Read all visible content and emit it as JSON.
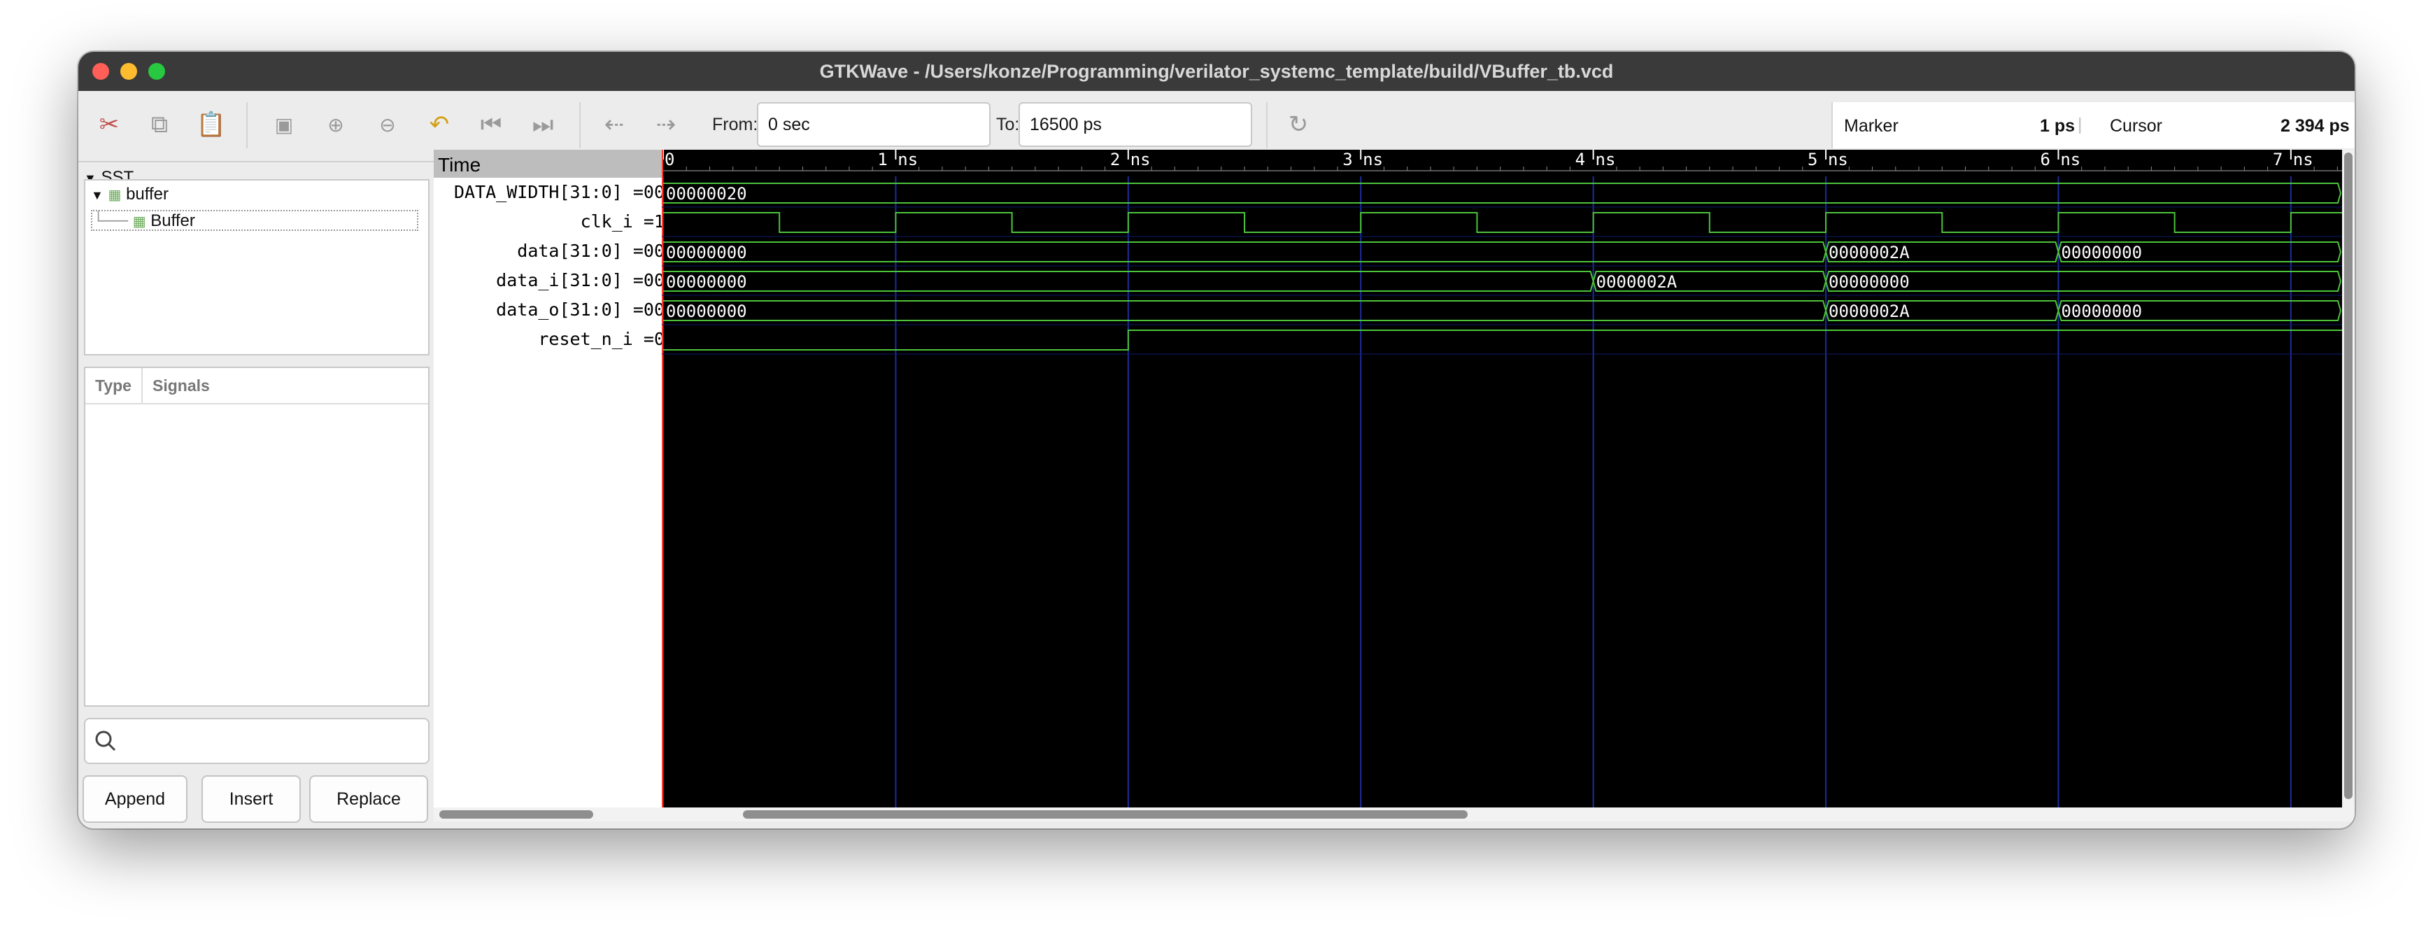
{
  "window": {
    "title": "GTKWave - /Users/konze/Programming/verilator_systemc_template/build/VBuffer_tb.vcd"
  },
  "toolbar": {
    "icons": [
      "cut-icon",
      "copy-icon",
      "paste-icon",
      "zoom-fit-icon",
      "zoom-in-icon",
      "zoom-out-icon",
      "undo-icon",
      "jump-start-icon",
      "jump-end-icon",
      "prev-edge-icon",
      "next-edge-icon",
      "reload-icon"
    ],
    "from_label": "From:",
    "from_value": "0 sec",
    "to_label": "To:",
    "to_value": "16500 ps",
    "marker_label": "Marker",
    "marker_value": "1 ps",
    "cursor_label": "Cursor",
    "cursor_value": "2 394 ps"
  },
  "sst": {
    "header": "SST",
    "tree": [
      {
        "label": "buffer",
        "level": 0
      },
      {
        "label": "Buffer",
        "level": 1
      }
    ]
  },
  "signals_panel": {
    "col_type": "Type",
    "col_signals": "Signals",
    "search_placeholder": ""
  },
  "buttons": {
    "append": "Append",
    "insert": "Insert",
    "replace": "Replace"
  },
  "names_panel": {
    "time_label": "Time",
    "signals": [
      {
        "name": "DATA_WIDTH[31:0] =00"
      },
      {
        "name": "clk_i =1"
      },
      {
        "name": "data[31:0] =00"
      },
      {
        "name": "data_i[31:0] =00"
      },
      {
        "name": "data_o[31:0] =00"
      },
      {
        "name": "reset_n_i =0"
      }
    ]
  },
  "timeline": {
    "unit_ns_ps": 1000,
    "ticks": [
      {
        "t": 0,
        "label": "0"
      },
      {
        "t": 1000,
        "label": "1 ns"
      },
      {
        "t": 2000,
        "label": "2 ns"
      },
      {
        "t": 3000,
        "label": "3 ns"
      },
      {
        "t": 4000,
        "label": "4 ns"
      },
      {
        "t": 5000,
        "label": "5 ns"
      },
      {
        "t": 6000,
        "label": "6 ns"
      },
      {
        "t": 7000,
        "label": "7 ns"
      }
    ],
    "visible_end_ps": 7220,
    "waves": [
      {
        "name": "DATA_WIDTH",
        "type": "bus",
        "segments": [
          {
            "start": 0,
            "end": 7220,
            "value": "00000020"
          }
        ]
      },
      {
        "name": "clk_i",
        "type": "bit",
        "initial": 1,
        "toggles": [
          500,
          1000,
          1500,
          2000,
          2500,
          3000,
          3500,
          4000,
          4500,
          5000,
          5500,
          6000,
          6500,
          7000
        ]
      },
      {
        "name": "data",
        "type": "bus",
        "segments": [
          {
            "start": 0,
            "end": 5000,
            "value": "00000000"
          },
          {
            "start": 5000,
            "end": 6000,
            "value": "0000002A"
          },
          {
            "start": 6000,
            "end": 7220,
            "value": "00000000"
          }
        ]
      },
      {
        "name": "data_i",
        "type": "bus",
        "segments": [
          {
            "start": 0,
            "end": 4000,
            "value": "00000000"
          },
          {
            "start": 4000,
            "end": 5000,
            "value": "0000002A"
          },
          {
            "start": 5000,
            "end": 7220,
            "value": "00000000"
          }
        ]
      },
      {
        "name": "data_o",
        "type": "bus",
        "segments": [
          {
            "start": 0,
            "end": 5000,
            "value": "00000000"
          },
          {
            "start": 5000,
            "end": 6000,
            "value": "0000002A"
          },
          {
            "start": 6000,
            "end": 7220,
            "value": "00000000"
          }
        ]
      },
      {
        "name": "reset_n_i",
        "type": "bit",
        "initial": 0,
        "toggles": [
          2000
        ]
      }
    ]
  },
  "colors": {
    "wave_green": "#4cc33b",
    "grid_blue": "#1c2d9e",
    "wave_bg": "#000000"
  }
}
